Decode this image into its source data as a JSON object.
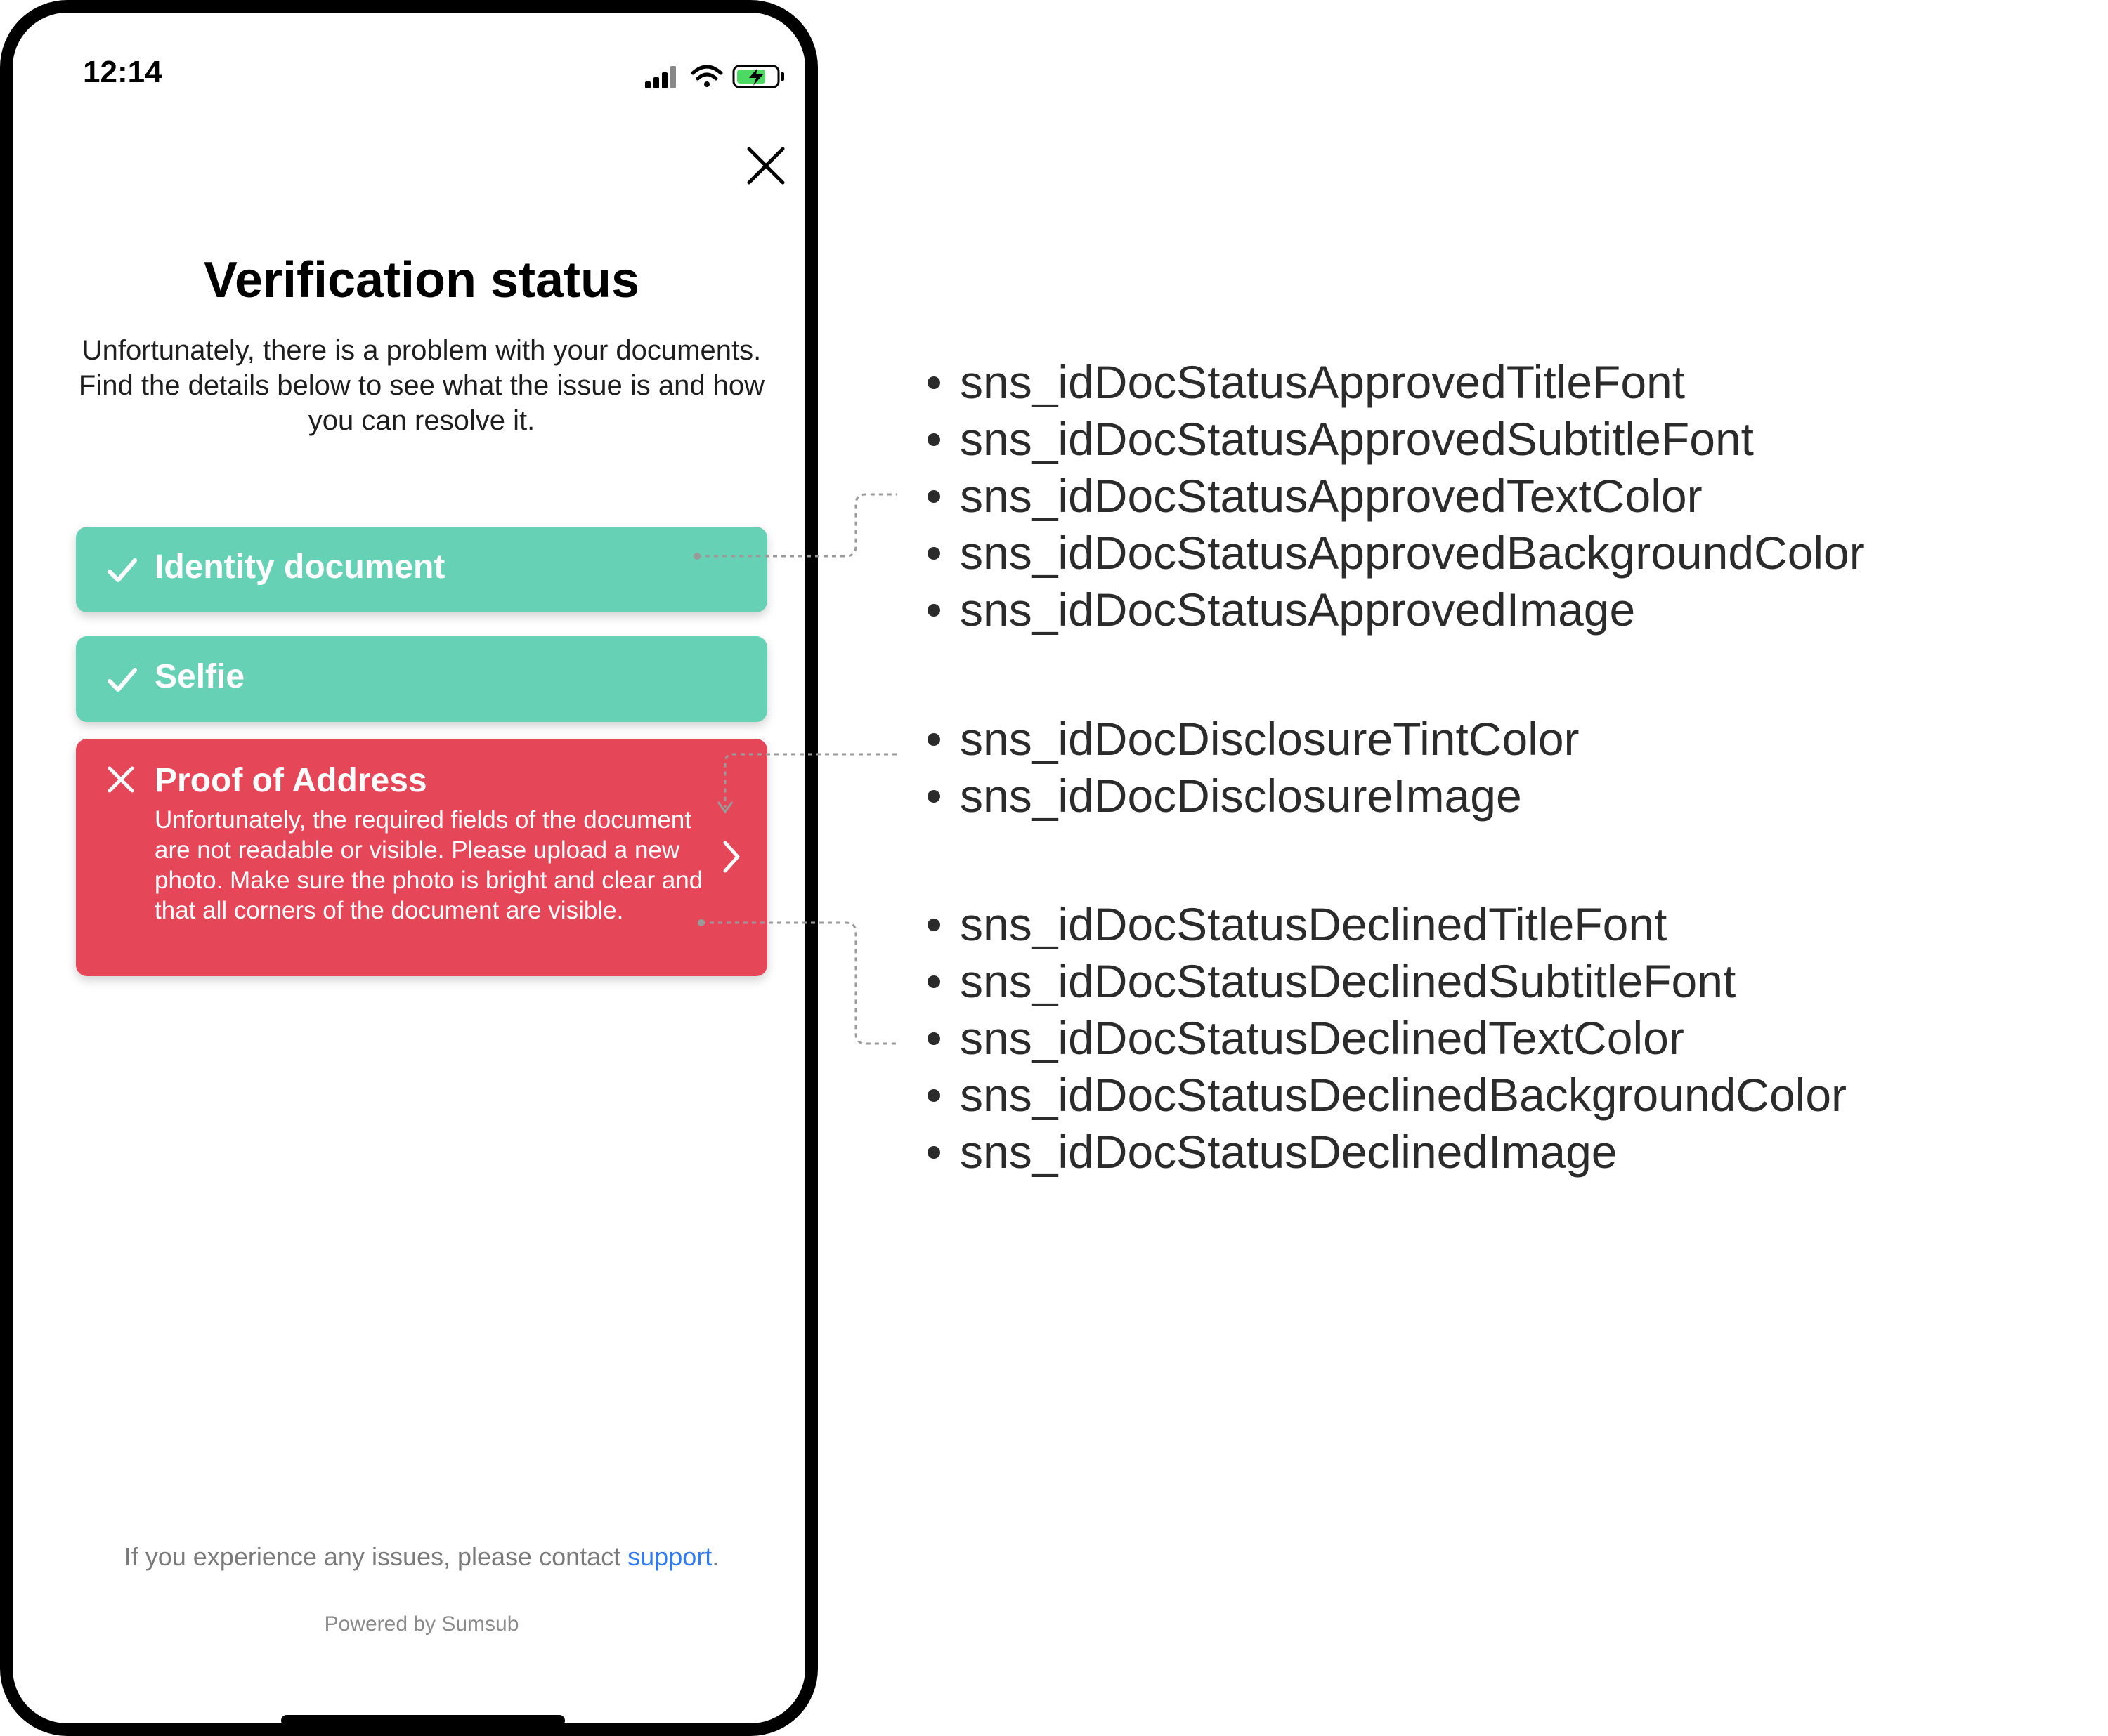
{
  "status_bar": {
    "time": "12:14"
  },
  "screen": {
    "title": "Verification status",
    "subtitle": "Unfortunately, there is a problem with your documents. Find the details below to see what the issue is and how you can resolve it.",
    "cards": [
      {
        "status": "approved",
        "label": "Identity document"
      },
      {
        "status": "approved",
        "label": "Selfie"
      },
      {
        "status": "declined",
        "label": "Proof of Address",
        "description": "Unfortunately, the required fields of the document are not readable or visible. Please upload a new photo. Make sure the photo is bright and clear and that all corners of the document are visible."
      }
    ],
    "footer": {
      "text": "If you experience any issues, please contact ",
      "link": "support",
      "suffix": "."
    },
    "powered_by": "Powered by Sumsub"
  },
  "annotations": {
    "approved_keys": [
      "sns_idDocStatusApprovedTitleFont",
      "sns_idDocStatusApprovedSubtitleFont",
      "sns_idDocStatusApprovedTextColor",
      "sns_idDocStatusApprovedBackgroundColor",
      "sns_idDocStatusApprovedImage"
    ],
    "disclosure_keys": [
      "sns_idDocDisclosureTintColor",
      "sns_idDocDisclosureImage"
    ],
    "declined_keys": [
      "sns_idDocStatusDeclinedTitleFont",
      "sns_idDocStatusDeclinedSubtitleFont",
      "sns_idDocStatusDeclinedTextColor",
      "sns_idDocStatusDeclinedBackgroundColor",
      "sns_idDocStatusDeclinedImage"
    ]
  },
  "colors": {
    "approved_bg": "#66d1b5",
    "declined_bg": "#e54759",
    "link": "#2f7bf6"
  },
  "icons": [
    "cellular-signal-icon",
    "wifi-icon",
    "battery-charging-icon",
    "close-icon",
    "checkmark-icon",
    "x-mark-icon",
    "chevron-right-icon"
  ]
}
